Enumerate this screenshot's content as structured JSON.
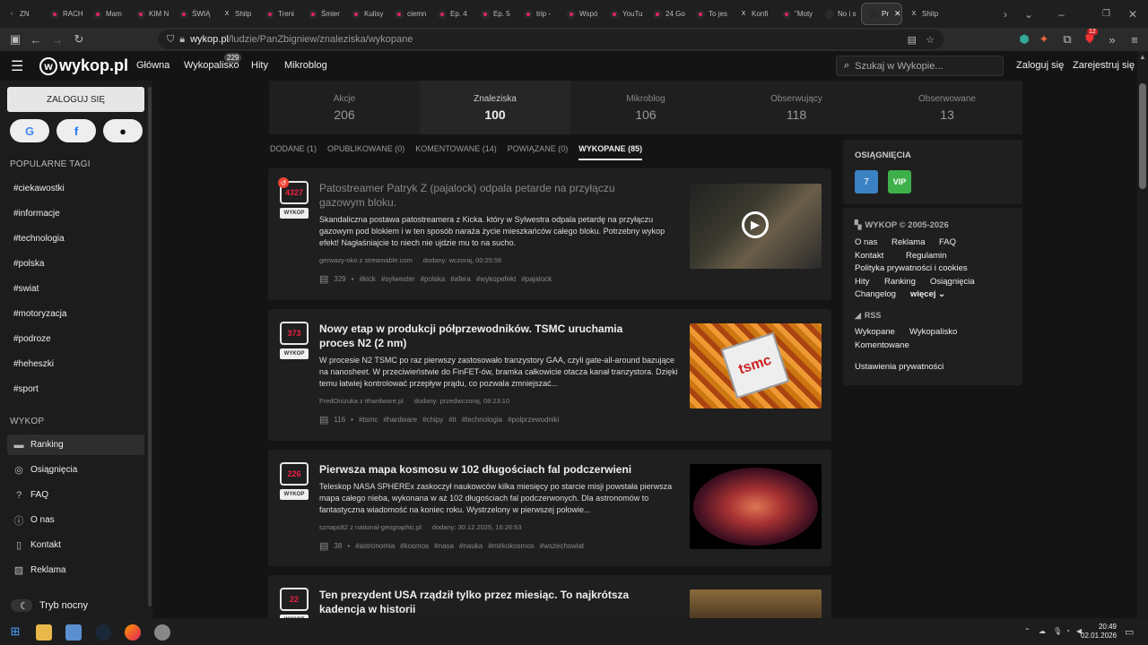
{
  "browser": {
    "tabs": [
      {
        "label": "ZN",
        "icon": "back-arrow"
      },
      {
        "label": "RACH",
        "icon": "youtube"
      },
      {
        "label": "Mam",
        "icon": "youtube"
      },
      {
        "label": "KIM N",
        "icon": "youtube"
      },
      {
        "label": "ŚWIĄ",
        "icon": "youtube"
      },
      {
        "label": "Shitp",
        "icon": "x"
      },
      {
        "label": "Treni",
        "icon": "youtube"
      },
      {
        "label": "Śmier",
        "icon": "youtube"
      },
      {
        "label": "Kulisy",
        "icon": "youtube"
      },
      {
        "label": "ciemn",
        "icon": "youtube"
      },
      {
        "label": "Ep. 4",
        "icon": "youtube"
      },
      {
        "label": "Ep. 5",
        "icon": "youtube"
      },
      {
        "label": "trip -",
        "icon": "youtube"
      },
      {
        "label": "Wspó",
        "icon": "youtube"
      },
      {
        "label": "YouTu",
        "icon": "youtube"
      },
      {
        "label": "24 Go",
        "icon": "youtube"
      },
      {
        "label": "To jes",
        "icon": "youtube"
      },
      {
        "label": "Konfi",
        "icon": "x"
      },
      {
        "label": "\"Moty",
        "icon": "youtube"
      },
      {
        "label": "No i s",
        "icon": "page"
      },
      {
        "label": "Pr",
        "icon": "page",
        "active": true
      },
      {
        "label": "Shitp",
        "icon": "x"
      }
    ],
    "url_host": "wykop.pl",
    "url_path": "/ludzie/PanZbigniew/znaleziska/wykopane",
    "ext_badge": "12"
  },
  "header": {
    "logo": "wykop.pl",
    "nav": [
      "Główna",
      "Wykopalisko",
      "Hity",
      "Mikroblog"
    ],
    "wykopalisko_badge": "229",
    "search_placeholder": "Szukaj w Wykopie...",
    "login": "Zaloguj się",
    "register": "Zarejestruj się"
  },
  "sidebar": {
    "login_button": "ZALOGUJ SIĘ",
    "popular_heading": "POPULARNE TAGI",
    "tags": [
      "#ciekawostki",
      "#informacje",
      "#technologia",
      "#polska",
      "#swiat",
      "#motoryzacja",
      "#podroze",
      "#heheszki",
      "#sport"
    ],
    "wykop_heading": "WYKOP",
    "nav": [
      "Ranking",
      "Osiągnięcia",
      "FAQ",
      "O nas",
      "Kontakt",
      "Reklama"
    ],
    "night_mode": "Tryb nocny"
  },
  "stats": [
    {
      "label": "Akcje",
      "value": "206"
    },
    {
      "label": "Znaleziska",
      "value": "100"
    },
    {
      "label": "Mikroblog",
      "value": "106"
    },
    {
      "label": "Obserwujący",
      "value": "118"
    },
    {
      "label": "Obserwowane",
      "value": "13"
    }
  ],
  "subtabs": [
    "DODANE (1)",
    "OPUBLIKOWANE (0)",
    "KOMENTOWANE (14)",
    "POWIĄZANE (0)",
    "WYKOPANE (85)"
  ],
  "wykop_label": "WYKOP",
  "posts": [
    {
      "votes": "4327",
      "title": "Patostreamer Patryk Z (pajalock) odpala petarde na przyłączu gazowym bloku.",
      "desc": "Skandaliczna postawa patostreamera z Kicka. który w Sylwestra odpala petardę na przyłączu gazowym pod blokiem i w ten sposób naraża życie mieszkańców całego bloku. Potrzebny wykop efekt! Nagłaśniajcie to niech nie ujdzie mu to na sucho.",
      "author": "gerwazy-oko z streamable.com",
      "date": "dodany: wczoraj, 00:25:56",
      "comments": "329",
      "tags": [
        "#kick",
        "#sylwester",
        "#polska",
        "#afera",
        "#wykopefekt",
        "#pajalock"
      ]
    },
    {
      "votes": "373",
      "title": "Nowy etap w produkcji półprzewodników. TSMC uruchamia proces N2 (2 nm)",
      "desc": "W procesie N2 TSMC po raz pierwszy zastosowało tranzystory GAA, czyli gate-all-around bazujące na nanosheet. W przeciwieństwie do FinFET-ów, bramka całkowicie otacza kanał tranzystora. Dzięki temu łatwiej kontrolować przepływ prądu, co pozwala zmniejszać...",
      "author": "FredOnizuka z ithardware.pl",
      "date": "dodany: przedwczoraj, 08:23:10",
      "comments": "116",
      "tags": [
        "#tsmc",
        "#hardware",
        "#chipy",
        "#it",
        "#technologia",
        "#polprzewodniki"
      ]
    },
    {
      "votes": "226",
      "title": "Pierwsza mapa kosmosu w 102 długościach fal podczerwieni",
      "desc": "Teleskop NASA SPHEREx zaskoczył naukowców kilka miesięcy po starcie misji powstała pierwsza mapa całego nieba, wykonana w aż 102 długościach fal podczerwonych. Dla astronomów to fantastyczna wiadomość na koniec roku. Wystrzelony w pierwszej połowie...",
      "author": "sznaps82 z national-geographic.pl",
      "date": "dodany: 30.12.2025, 16:26:53",
      "comments": "38",
      "tags": [
        "#astronomia",
        "#kosmos",
        "#nasa",
        "#nauka",
        "#mirkokosmos",
        "#wszechswiat"
      ]
    },
    {
      "votes": "22",
      "title": "Ten prezydent USA rządził tylko przez miesiąc. To najkrótsza kadencja w historii"
    }
  ],
  "thumb_text": "tsmc",
  "right": {
    "achievements_heading": "OSIĄGNIĘCIA",
    "achievement_badges": [
      "7",
      "VIP"
    ],
    "copyright": "WYKOP © 2005-2026",
    "links_row1": [
      "O nas",
      "Reklama",
      "FAQ"
    ],
    "links_row2": [
      "Kontakt",
      "Regulamin"
    ],
    "links_row3": [
      "Polityka prywatności i cookies"
    ],
    "links_row4": [
      "Hity",
      "Ranking",
      "Osiągnięcia"
    ],
    "links_row5": [
      "Changelog",
      "więcej"
    ],
    "rss": "RSS",
    "rss_links": [
      "Wykopane",
      "Wykopalisko",
      "Komentowane"
    ],
    "privacy_settings": "Ustawienia prywatności"
  },
  "taskbar": {
    "time": "20:49",
    "date": "02.01.2026"
  }
}
